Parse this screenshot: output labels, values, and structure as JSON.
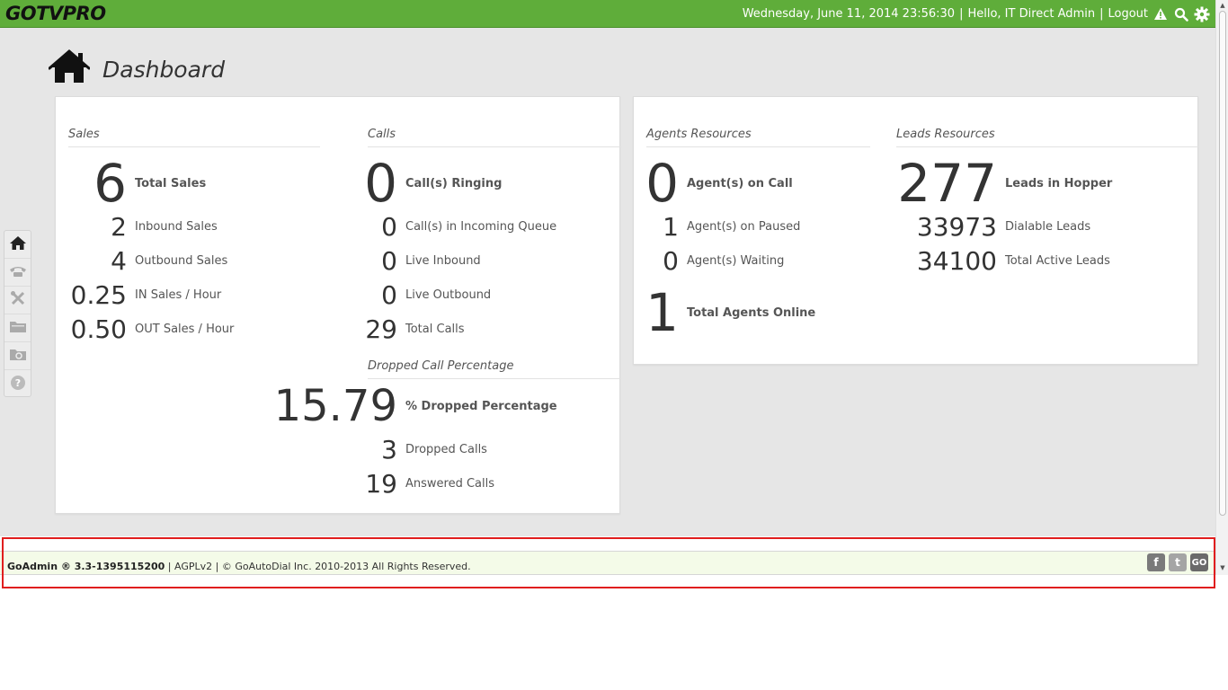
{
  "app": {
    "logo": "GOTVPRO"
  },
  "topbar": {
    "datetime": "Wednesday, June 11, 2014 23:56:30",
    "greeting": "Hello, IT Direct Admin",
    "logout": "Logout",
    "icons": [
      "warning-icon",
      "search-icon",
      "gear-icon"
    ]
  },
  "page": {
    "title": "Dashboard"
  },
  "sidenav": {
    "items": [
      "home-icon",
      "phone-icon",
      "tools-icon",
      "folder-icon",
      "folder-search-icon",
      "help-icon"
    ]
  },
  "sales": {
    "title": "Sales",
    "total": {
      "value": "6",
      "label": "Total Sales"
    },
    "inbound": {
      "value": "2",
      "label": "Inbound Sales"
    },
    "outbound": {
      "value": "4",
      "label": "Outbound Sales"
    },
    "in_per_hour": {
      "value": "0.25",
      "label": "IN Sales / Hour"
    },
    "out_per_hour": {
      "value": "0.50",
      "label": "OUT Sales / Hour"
    }
  },
  "calls": {
    "title": "Calls",
    "ringing": {
      "value": "0",
      "label": "Call(s) Ringing"
    },
    "incoming_queue": {
      "value": "0",
      "label": "Call(s) in Incoming Queue"
    },
    "live_inbound": {
      "value": "0",
      "label": "Live Inbound"
    },
    "live_outbound": {
      "value": "0",
      "label": "Live Outbound"
    },
    "total": {
      "value": "29",
      "label": "Total Calls"
    }
  },
  "dropped": {
    "title": "Dropped Call Percentage",
    "percentage": {
      "value": "15.79",
      "label": "% Dropped Percentage"
    },
    "dropped_calls": {
      "value": "3",
      "label": "Dropped Calls"
    },
    "answered_calls": {
      "value": "19",
      "label": "Answered Calls"
    }
  },
  "agents": {
    "title": "Agents Resources",
    "on_call": {
      "value": "0",
      "label": "Agent(s) on Call"
    },
    "paused": {
      "value": "1",
      "label": "Agent(s) on Paused"
    },
    "waiting": {
      "value": "0",
      "label": "Agent(s) Waiting"
    },
    "online": {
      "value": "1",
      "label": "Total Agents Online"
    }
  },
  "leads": {
    "title": "Leads Resources",
    "hopper": {
      "value": "277",
      "label": "Leads in Hopper"
    },
    "dialable": {
      "value": "33973",
      "label": "Dialable Leads"
    },
    "active": {
      "value": "34100",
      "label": "Total Active Leads"
    }
  },
  "footer": {
    "version": "GoAdmin ® 3.3-1395115200",
    "rest": " | AGPLv2 | © GoAutoDial Inc. 2010-2013 All Rights Reserved.",
    "social": [
      "facebook-icon",
      "twitter-icon",
      "goautodial-icon"
    ],
    "social_labels": {
      "facebook": "f",
      "twitter": "t",
      "go": "GO"
    }
  },
  "colors": {
    "topbar": "#5fad3a",
    "footer": "#f4fbe8",
    "highlight": "#e01e1e",
    "background": "#e6e6e6"
  }
}
